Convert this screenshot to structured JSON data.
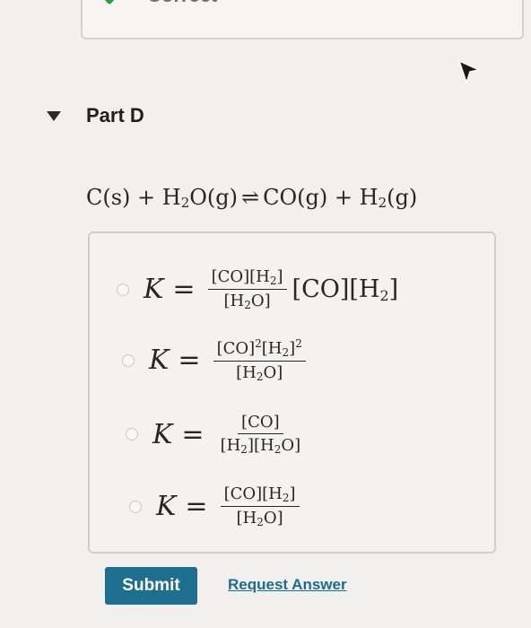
{
  "previous_part": {
    "status_label": "Correct",
    "icon": "green-check-icon",
    "status_color": "#2e9c48"
  },
  "part": {
    "title": "Part D",
    "icon": "triangle-down-icon"
  },
  "equation": {
    "c": "C(s)",
    "plus1": " + H",
    "h2o_sub": "2",
    "h2o_rest": "O(g)",
    "arrow": "⇌",
    "co": "CO(g)",
    "plus2": " + H",
    "h2_sub": "2",
    "h2_rest": "(g)"
  },
  "choices": [
    {
      "k": "K",
      "eq": "=",
      "num": {
        "a": "[CO][H",
        "a_sub": "2",
        "b": "]"
      },
      "den": {
        "a": "[H",
        "a_sub": "2",
        "b": "O]"
      },
      "extra": {
        "a": "[CO][H",
        "a_sub": "2",
        "b": "]"
      }
    },
    {
      "k": "K",
      "eq": "=",
      "num": {
        "a": "[CO]",
        "a_sup": "2",
        "b": "[H",
        "b_sub": "2",
        "c": "]",
        "c_sup": "2"
      },
      "den": {
        "a": "[H",
        "a_sub": "2",
        "b": "O]"
      }
    },
    {
      "k": "K",
      "eq": "=",
      "num": {
        "a": "[CO]"
      },
      "den": {
        "a": "[H",
        "a_sub": "2",
        "b": "][H",
        "b_sub": "2",
        "c": "O]"
      }
    },
    {
      "k": "K",
      "eq": "=",
      "num": {
        "a": "[CO][H",
        "a_sub": "2",
        "b": "]"
      },
      "den": {
        "a": "[H",
        "a_sub": "2",
        "b": "O]"
      }
    }
  ],
  "actions": {
    "submit_label": "Submit",
    "request_label": "Request Answer",
    "button_color": "#1d6e8f",
    "link_color": "#1c6c92"
  }
}
